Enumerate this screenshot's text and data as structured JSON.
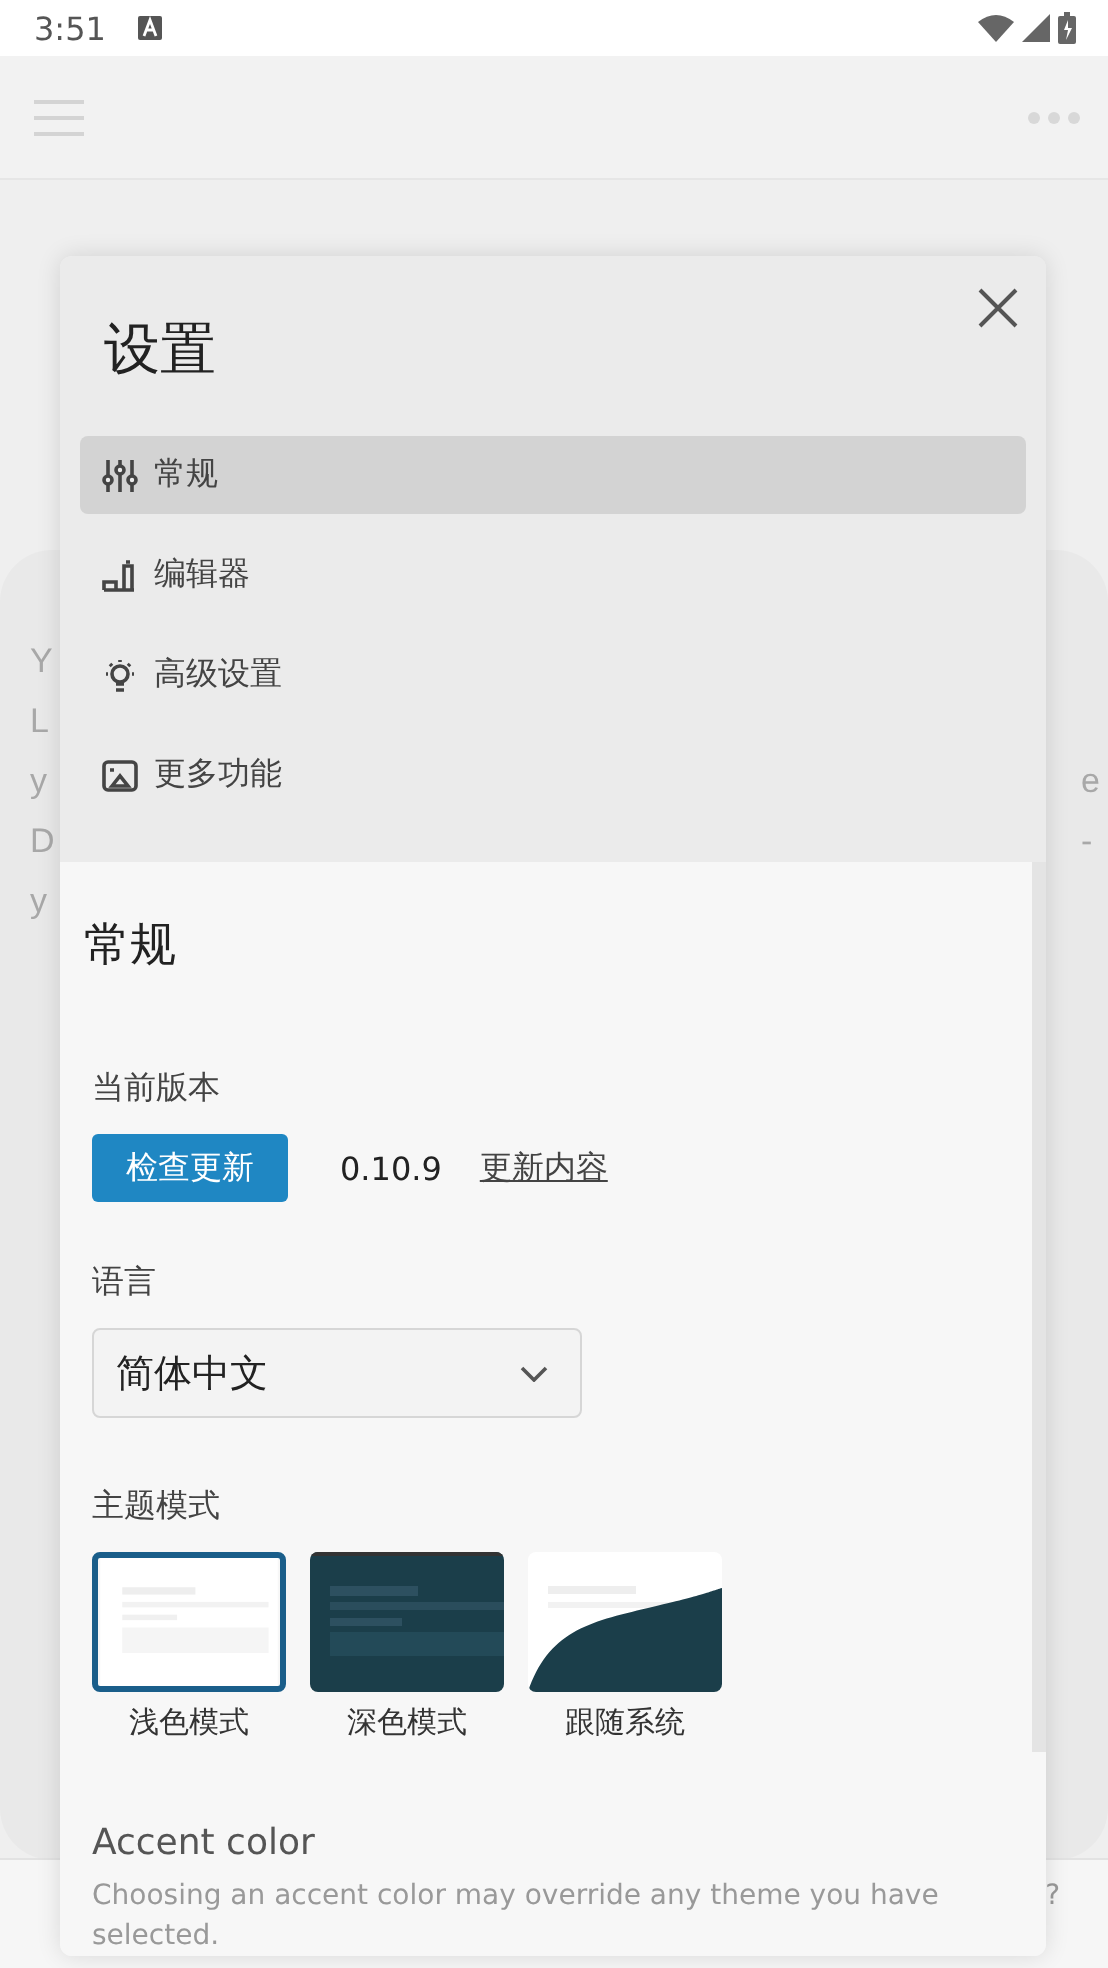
{
  "status_bar": {
    "time": "3:51"
  },
  "background": {
    "left_letters": [
      "Y",
      "L",
      "y",
      "D",
      "y"
    ],
    "right_letters": [
      "e",
      "-"
    ],
    "corner_mark": "?"
  },
  "dialog": {
    "title": "设置",
    "nav": [
      {
        "label": "常规",
        "kind": "sliders",
        "selected": true
      },
      {
        "label": "编辑器",
        "kind": "editor",
        "selected": false
      },
      {
        "label": "高级设置",
        "kind": "bulb",
        "selected": false
      },
      {
        "label": "更多功能",
        "kind": "picture",
        "selected": false
      }
    ],
    "section_title": "常规",
    "version": {
      "label": "当前版本",
      "button": "检查更新",
      "number": "0.10.9",
      "link": "更新内容"
    },
    "language": {
      "label": "语言",
      "value": "简体中文"
    },
    "theme": {
      "label": "主题模式",
      "options": [
        {
          "label": "浅色模式",
          "kind": "light",
          "selected": true
        },
        {
          "label": "深色模式",
          "kind": "dark",
          "selected": false
        },
        {
          "label": "跟随系统",
          "kind": "system",
          "selected": false
        }
      ]
    },
    "accent": {
      "title": "Accent color",
      "description": "Choosing an accent color may override any theme you have selected."
    }
  }
}
